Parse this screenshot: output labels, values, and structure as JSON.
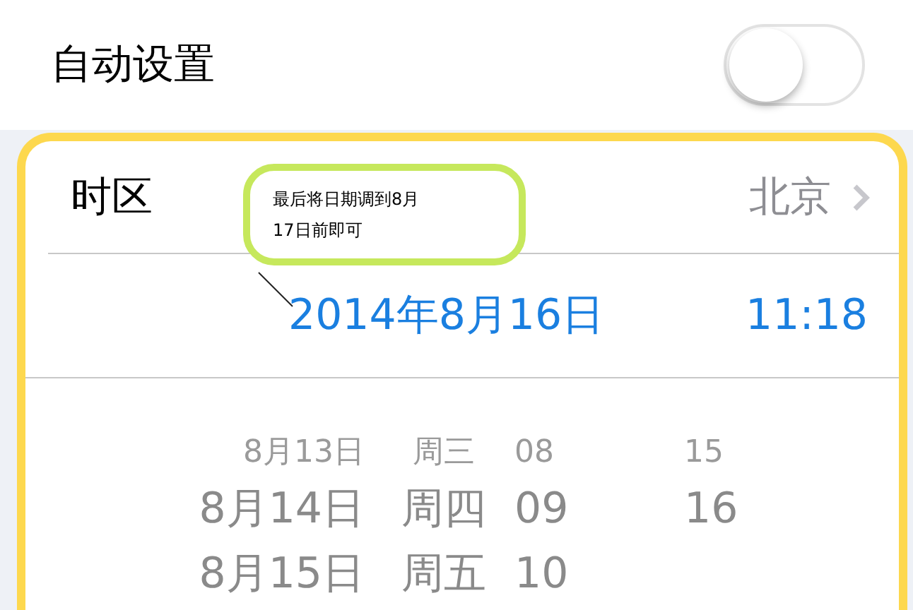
{
  "auto_setting": {
    "label": "自动设置",
    "on": false
  },
  "timezone": {
    "label": "时区",
    "value": "北京"
  },
  "annotation": {
    "lines": [
      "最后将日期调到8月",
      "17日前即可"
    ]
  },
  "date_time": {
    "date": "2014年8月16日",
    "time": "11:18"
  },
  "picker": {
    "rows": [
      {
        "kind": "far",
        "date": "8月13日",
        "weekday": "周三",
        "hour": "08",
        "minute": "15"
      },
      {
        "kind": "near",
        "date": "8月14日",
        "weekday": "周四",
        "hour": "09",
        "minute": "16"
      },
      {
        "kind": "near",
        "date": "8月15日",
        "weekday": "周五",
        "hour": "10"
      }
    ]
  }
}
